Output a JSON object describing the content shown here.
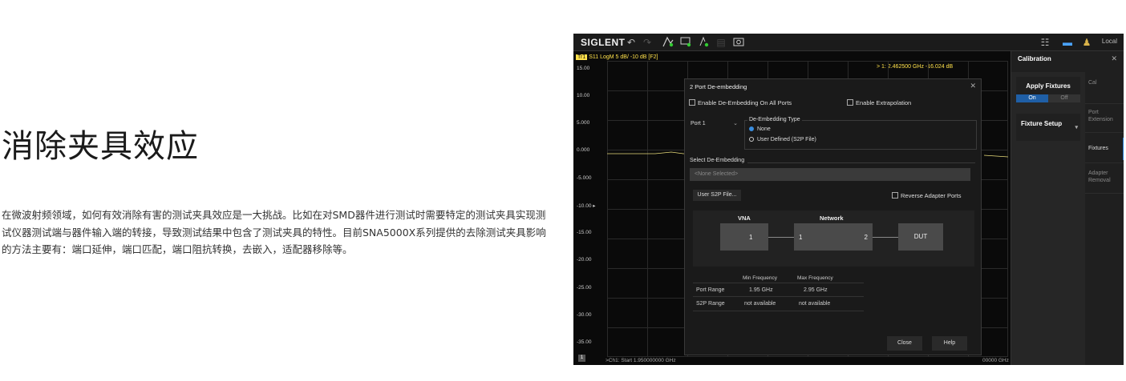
{
  "article": {
    "title": "消除夹具效应",
    "body": "在微波射频领域，如何有效消除有害的测试夹具效应是一大挑战。比如在对SMD器件进行测试时需要特定的测试夹具实现测试仪器测试端与器件输入端的转接，导致测试结果中包含了测试夹具的特性。目前SNA5000X系列提供的去除测试夹具影响的方法主要有：端口延伸，端口匹配，端口阻抗转换，去嵌入，适配器移除等。"
  },
  "toolbar": {
    "logo": "SIGLENT",
    "local": "Local"
  },
  "plot": {
    "trace_id": "Tr1",
    "trace_desc": "S11 LogM 5 dB/ -10 dB [F2]",
    "marker": "> 1:  2.462500 GHz    -16.024 dB",
    "y_labels": [
      "15.00",
      "10.00",
      "5.000",
      "0.000",
      "-5.000",
      "-10.00 ▸",
      "-15.00",
      "-20.00",
      "-25.00",
      "-30.00",
      "-35.00"
    ],
    "status_box": "1",
    "start": ">Ch1: Start 1.950000000 GHz",
    "stop": "00000 GHz"
  },
  "side": {
    "title": "Calibration",
    "close": "✕",
    "apply_fixtures": "Apply Fixtures",
    "on": "On",
    "off": "Off",
    "fixture_setup": "Fixture Setup",
    "chev": "▾",
    "tabs": [
      "Cal",
      "Port\nExtension",
      "Fixtures",
      "Adapter\nRemoval"
    ]
  },
  "dialog": {
    "title": "2 Port De-embedding",
    "close_x": "✕",
    "enable_all": "Enable De-Embedding On All Ports",
    "enable_extrap": "Enable Extrapolation",
    "port": "Port 1",
    "port_chev": "⌄",
    "type_label": "De-Embedding Type",
    "opt_none": "None",
    "opt_user": "User Defined (S2P File)",
    "select_label": "Select De-Embedding",
    "none_selected": "<None Selected>",
    "user_s2p": "User S2P File...",
    "reverse": "Reverse Adapter Ports",
    "vna_label": "VNA",
    "network_label": "Network",
    "vna_port": "1",
    "net_in": "1",
    "net_out": "2",
    "dut": "DUT",
    "col_min": "Min Frequency",
    "col_max": "Max Frequency",
    "row1_name": "Port Range",
    "row1_min": "1.95 GHz",
    "row1_max": "2.95 GHz",
    "row2_name": "S2P Range",
    "row2_min": "not available",
    "row2_max": "not available",
    "close": "Close",
    "help": "Help"
  }
}
